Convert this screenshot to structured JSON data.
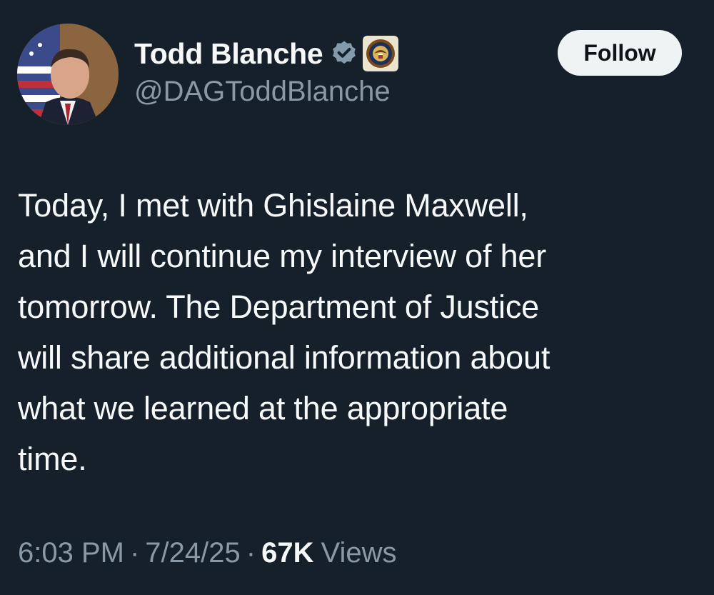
{
  "author": {
    "display_name": "Todd Blanche",
    "handle": "@DAGToddBlanche",
    "verified_icon": "verified-badge-icon",
    "affiliate_icon": "doj-seal-icon"
  },
  "follow_button": {
    "label": "Follow"
  },
  "tweet": {
    "lines": [
      "Today, I met with Ghislaine Maxwell,",
      "and I will continue my interview of her",
      "tomorrow. The Department of Justice",
      "will share additional information about",
      "what we learned at the appropriate",
      "time."
    ]
  },
  "meta": {
    "time": "6:03 PM",
    "date": "7/24/25",
    "separator": "·",
    "views_count": "67K",
    "views_label": "Views"
  },
  "colors": {
    "background": "#15202b",
    "text": "#f7f9f9",
    "secondary_text": "#8b98a5",
    "button_bg": "#eff3f4"
  }
}
